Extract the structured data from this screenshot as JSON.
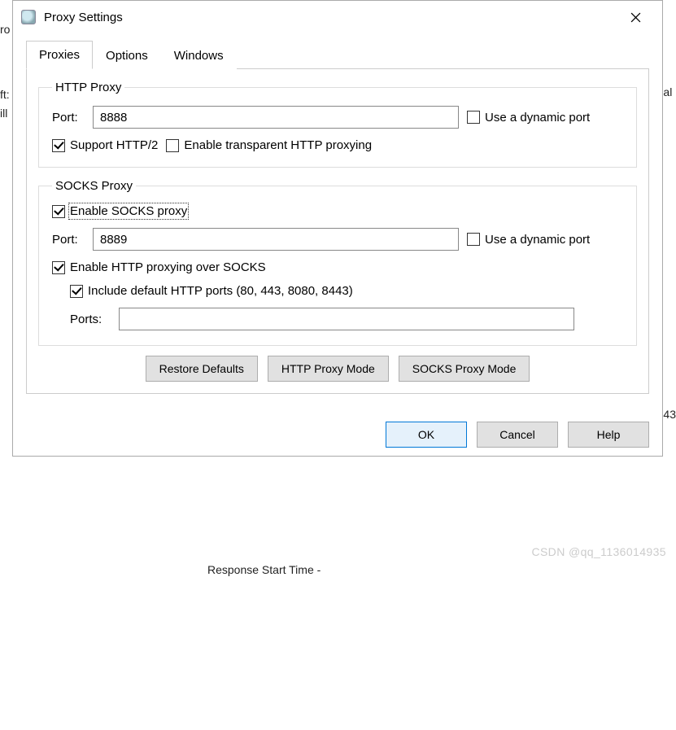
{
  "window": {
    "title": "Proxy Settings"
  },
  "tabs": [
    {
      "label": "Proxies",
      "active": true
    },
    {
      "label": "Options",
      "active": false
    },
    {
      "label": "Windows",
      "active": false
    }
  ],
  "http_proxy": {
    "legend": "HTTP Proxy",
    "port_label": "Port:",
    "port_value": "8888",
    "dynamic_port_label": "Use a dynamic port",
    "dynamic_port_checked": false,
    "support_http2_label": "Support HTTP/2",
    "support_http2_checked": true,
    "transparent_label": "Enable transparent HTTP proxying",
    "transparent_checked": false
  },
  "socks_proxy": {
    "legend": "SOCKS Proxy",
    "enable_label": "Enable SOCKS proxy",
    "enable_checked": true,
    "port_label": "Port:",
    "port_value": "8889",
    "dynamic_port_label": "Use a dynamic port",
    "dynamic_port_checked": false,
    "http_over_socks_label": "Enable HTTP proxying over SOCKS",
    "http_over_socks_checked": true,
    "include_defaults_label": "Include default HTTP ports (80, 443, 8080, 8443)",
    "include_defaults_checked": true,
    "ports_label": "Ports:",
    "ports_value": ""
  },
  "buttons": {
    "restore": "Restore Defaults",
    "http_mode": "HTTP Proxy Mode",
    "socks_mode": "SOCKS Proxy Mode",
    "ok": "OK",
    "cancel": "Cancel",
    "help": "Help"
  },
  "fragments": {
    "left1": "ro",
    "left2": "ft:",
    "left3": "ill",
    "right1": "al",
    "right2": "43",
    "bottom": "Response Start Time   -"
  },
  "watermark": "CSDN @qq_1136014935"
}
